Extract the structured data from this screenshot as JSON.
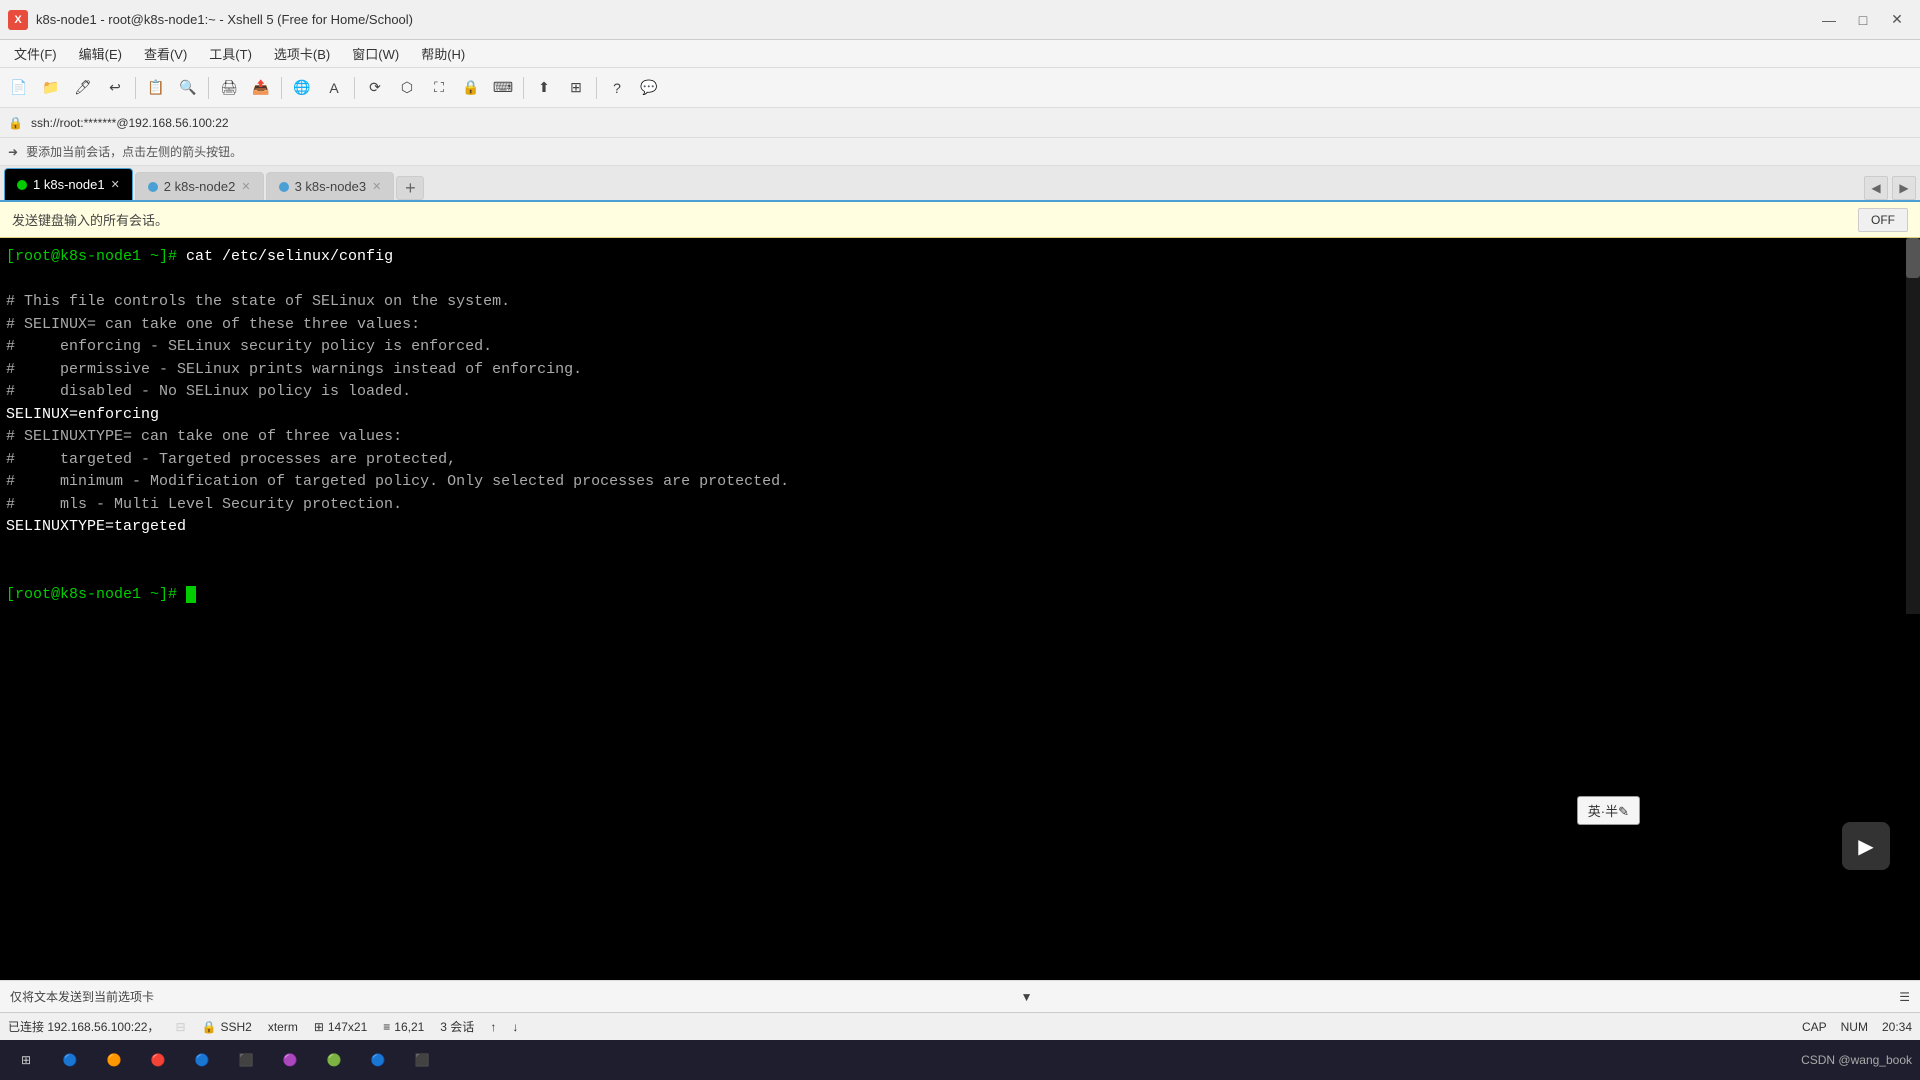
{
  "titlebar": {
    "icon_text": "X",
    "title": "k8s-node1 - root@k8s-node1:~ - Xshell 5 (Free for Home/School)",
    "minimize": "—",
    "maximize": "□",
    "close": "✕"
  },
  "menubar": {
    "items": [
      "文件(F)",
      "编辑(E)",
      "查看(V)",
      "工具(T)",
      "选项卡(B)",
      "窗口(W)",
      "帮助(H)"
    ]
  },
  "address": {
    "ssh": "ssh://root:*******@192.168.56.100:22"
  },
  "hint": {
    "text": "要添加当前会话，点击左侧的箭头按钮。"
  },
  "tabs": [
    {
      "num": "1",
      "label": "k8s-node1",
      "color": "#00cc00",
      "active": true
    },
    {
      "num": "2",
      "label": "k8s-node2",
      "color": "#4a9fd4",
      "active": false
    },
    {
      "num": "3",
      "label": "k8s-node3",
      "color": "#4a9fd4",
      "active": false
    }
  ],
  "broadcast": {
    "text": "发送键盘输入的所有会话。",
    "off_label": "OFF"
  },
  "terminal": {
    "prompt": "[root@k8s-node1 ~]# ",
    "command": "cat /etc/selinux/config",
    "lines": [
      "",
      "# This file controls the state of SELinux on the system.",
      "# SELINUX= can take one of these three values:",
      "#     enforcing - SELinux security policy is enforced.",
      "#     permissive - SELinux prints warnings instead of enforcing.",
      "#     disabled - No SELinux policy is loaded.",
      "SELINUX=enforcing",
      "# SELINUXTYPE= can take one of three values:",
      "#     targeted - Targeted processes are protected,",
      "#     minimum - Modification of targeted policy. Only selected processes are protected.",
      "#     mls - Multi Level Security protection.",
      "SELINUXTYPE=targeted",
      "",
      ""
    ],
    "prompt2": "[root@k8s-node1 ~]# "
  },
  "ime_popup": {
    "text": "英·半✎"
  },
  "send_bar": {
    "text": "仅将文本发送到当前选项卡"
  },
  "statusbar": {
    "connection": "已连接 192.168.56.100:22，",
    "ssh_label": "SSH2",
    "term_label": "xterm",
    "size": "147x21",
    "pos": "16,21",
    "sessions": "3 会话",
    "cap": "CAP",
    "num": "NUM",
    "time": "20:34"
  },
  "taskbar_apps": [
    "🔵",
    "🟠",
    "🔴",
    "🔵",
    "⬛",
    "🟣",
    "🟢",
    "🔵",
    "⬛"
  ]
}
